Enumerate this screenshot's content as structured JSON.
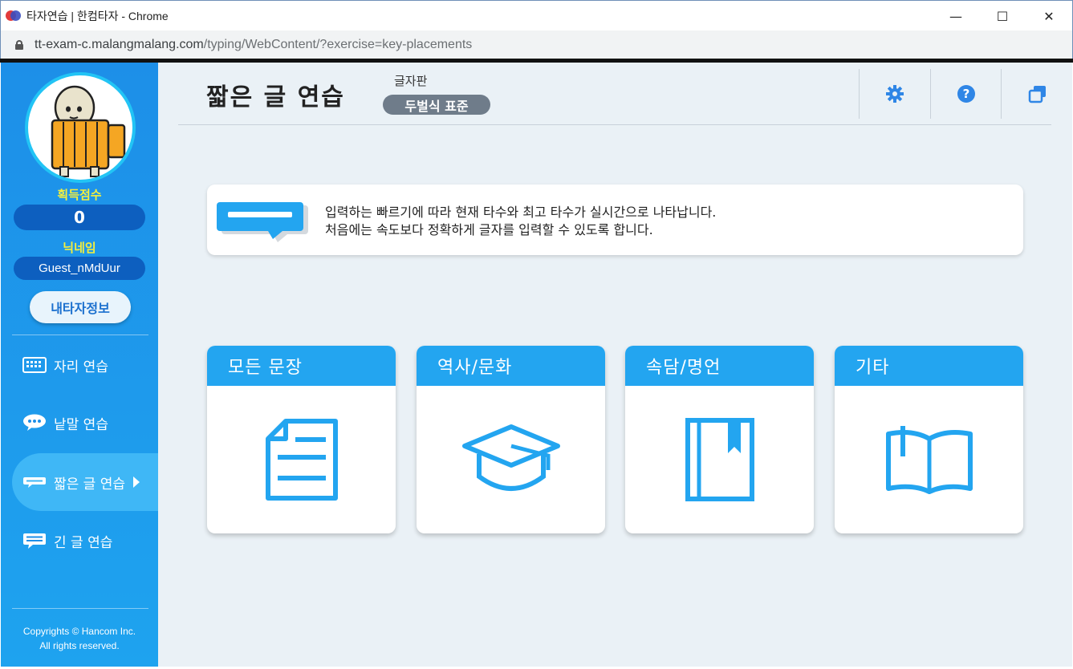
{
  "browser": {
    "window_title": "타자연습 | 한컴타자 - Chrome",
    "url_host": "tt-exam-c.malangmalang.com",
    "url_path": "/typing/WebContent/?exercise=key-placements",
    "controls": {
      "minimize": "—",
      "maximize": "☐",
      "close": "✕"
    }
  },
  "sidebar": {
    "score_label": "획득점수",
    "score_value": "0",
    "nickname_label": "닉네임",
    "nickname_value": "Guest_nMdUur",
    "my_info_button": "내타자정보",
    "nav": [
      {
        "label": "자리 연습",
        "icon": "keyboard-icon"
      },
      {
        "label": "낱말 연습",
        "icon": "speech-bubble-icon"
      },
      {
        "label": "짧은 글 연습",
        "icon": "short-text-icon",
        "active": true
      },
      {
        "label": "긴 글 연습",
        "icon": "long-text-icon"
      }
    ],
    "copyright_line1": "Copyrights © Hancom Inc.",
    "copyright_line2": "All rights reserved."
  },
  "header": {
    "title": "짧은 글 연습",
    "keyboard_label": "글자판",
    "keyboard_value": "두벌식 표준",
    "icons": [
      "gear-icon",
      "help-icon",
      "window-icon"
    ]
  },
  "info": {
    "line1": "입력하는 빠르기에 따라 현재 타수와 최고 타수가 실시간으로 나타납니다.",
    "line2": "처음에는 속도보다 정확하게 글자를 입력할 수 있도록 합니다."
  },
  "categories": [
    {
      "label": "모든 문장",
      "icon": "document-icon"
    },
    {
      "label": "역사/문화",
      "icon": "graduation-cap-icon"
    },
    {
      "label": "속담/명언",
      "icon": "bookmark-book-icon"
    },
    {
      "label": "기타",
      "icon": "open-book-icon"
    }
  ],
  "colors": {
    "sidebar": "#1d8fe8",
    "accent": "#23a5f0",
    "main_bg": "#eaf1f6",
    "highlight_text": "#f4ef3d"
  }
}
